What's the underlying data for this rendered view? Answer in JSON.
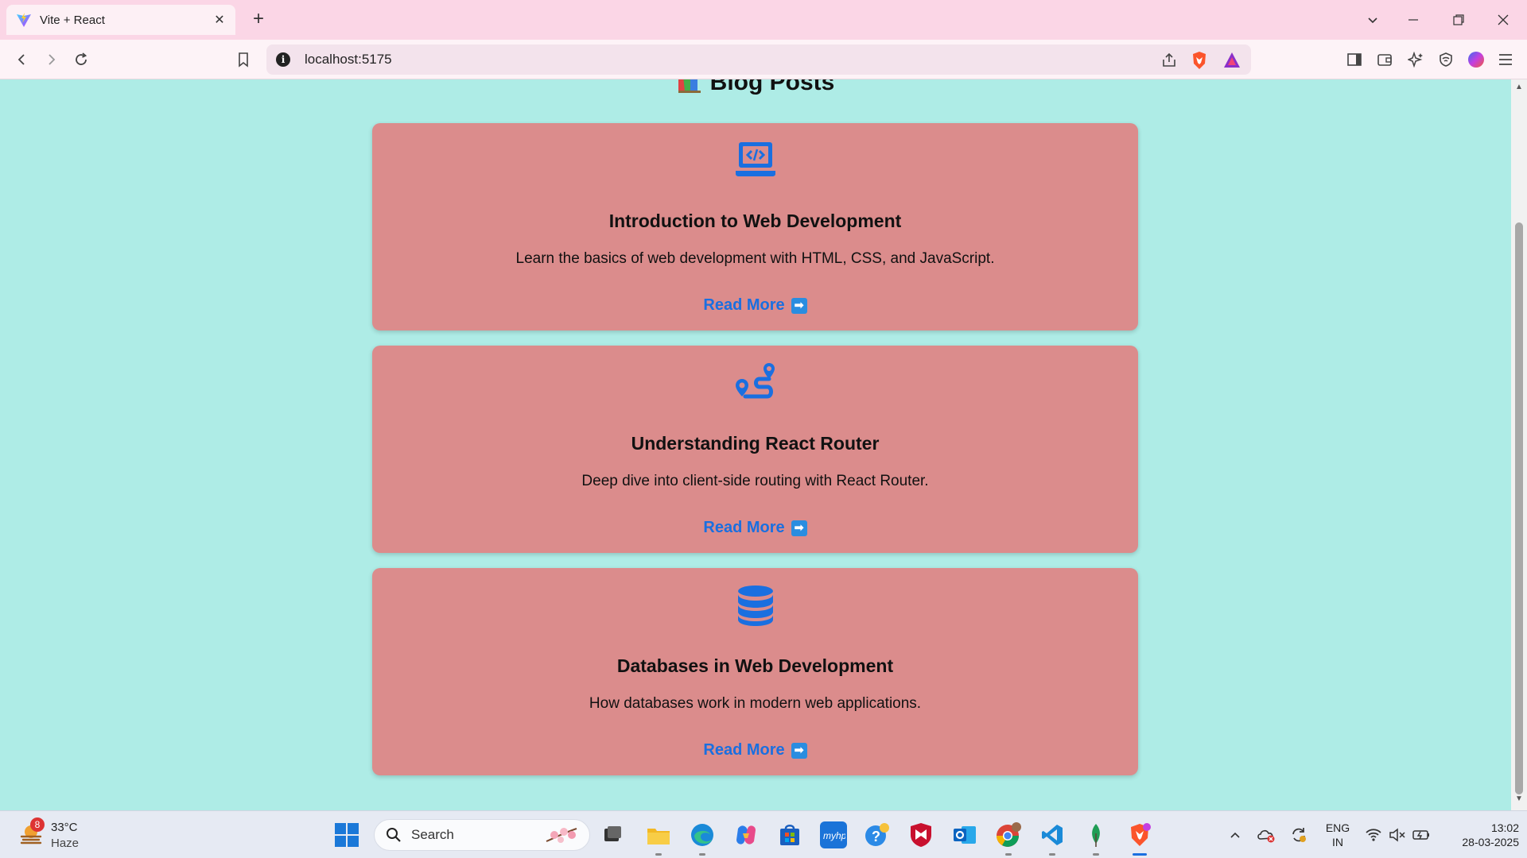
{
  "browser": {
    "tab_title": "Vite + React",
    "url": "localhost:5175"
  },
  "page": {
    "title": "Blog Posts",
    "posts": [
      {
        "title": "Introduction to Web Development",
        "description": "Learn the basics of web development with HTML, CSS, and JavaScript.",
        "link_label": "Read More",
        "icon": "laptop-code-icon"
      },
      {
        "title": "Understanding React Router",
        "description": "Deep dive into client-side routing with React Router.",
        "link_label": "Read More",
        "icon": "route-icon"
      },
      {
        "title": "Databases in Web Development",
        "description": "How databases work in modern web applications.",
        "link_label": "Read More",
        "icon": "database-icon"
      }
    ],
    "accent_color": "#1a6fe0",
    "card_color": "#db8c8c",
    "background_color": "#aeece6"
  },
  "taskbar": {
    "weather_badge": "8",
    "weather_temp": "33°C",
    "weather_condition": "Haze",
    "search_label": "Search",
    "language_line1": "ENG",
    "language_line2": "IN",
    "time": "13:02",
    "date": "28-03-2025"
  }
}
